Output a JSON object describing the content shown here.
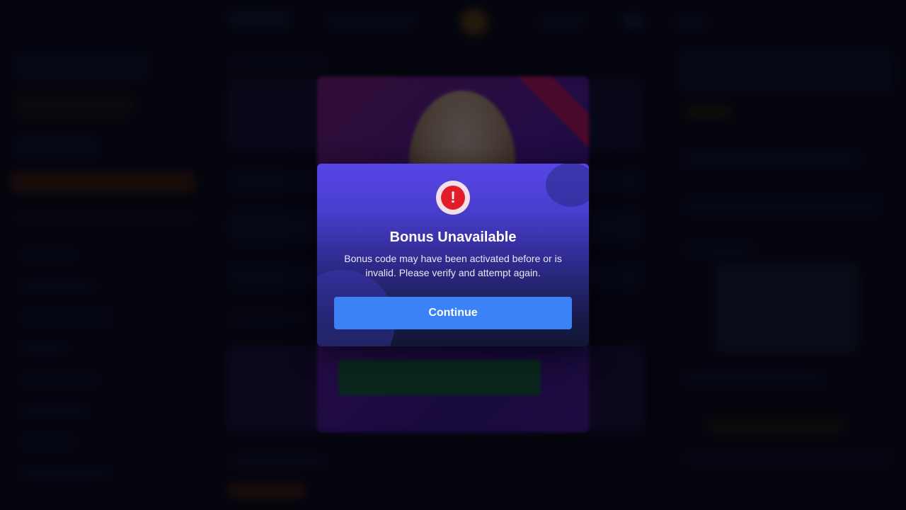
{
  "dialog": {
    "icon": "alert-exclamation-icon",
    "icon_glyph": "!",
    "title": "Bonus Unavailable",
    "message": "Bonus code may have been activated before or is invalid. Please verify and attempt again.",
    "continue_label": "Continue"
  },
  "colors": {
    "page_bg": "#05060f",
    "modal_top": "#5646e6",
    "modal_bottom": "#121634",
    "alert_red": "#e11d2a",
    "button_blue": "#3b82f6"
  }
}
